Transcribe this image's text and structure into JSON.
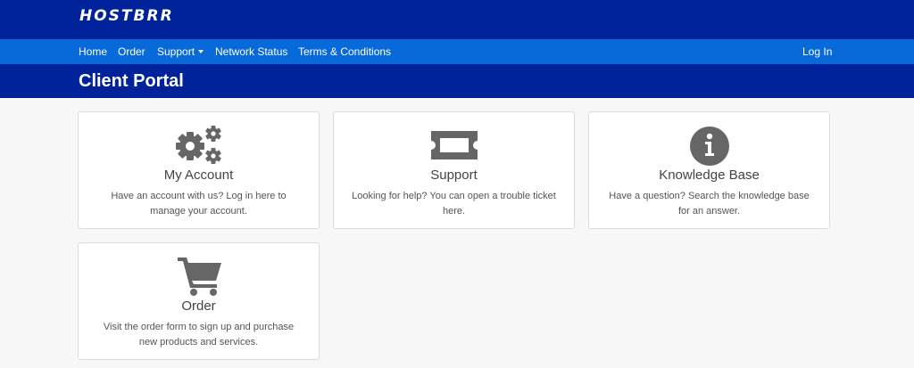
{
  "brand": {
    "logo_text": "HOSTBRR"
  },
  "nav": {
    "items": [
      {
        "label": "Home"
      },
      {
        "label": "Order"
      },
      {
        "label": "Support"
      },
      {
        "label": "Network Status"
      },
      {
        "label": "Terms & Conditions"
      }
    ],
    "login_label": "Log In"
  },
  "page": {
    "title": "Client Portal"
  },
  "cards": [
    {
      "icon": "gears-icon",
      "title": "My Account",
      "description": "Have an account with us? Log in here to manage your account."
    },
    {
      "icon": "ticket-icon",
      "title": "Support",
      "description": "Looking for help? You can open a trouble ticket here."
    },
    {
      "icon": "info-circle-icon",
      "title": "Knowledge Base",
      "description": "Have a question? Search the knowledge base for an answer."
    },
    {
      "icon": "shopping-cart-icon",
      "title": "Order",
      "description": "Visit the order form to sign up and purchase new products and services."
    }
  ],
  "colors": {
    "header_dark": "#00239c",
    "nav_blue": "#0869d9",
    "icon_gray": "#666666",
    "background": "#f7f7f7"
  }
}
